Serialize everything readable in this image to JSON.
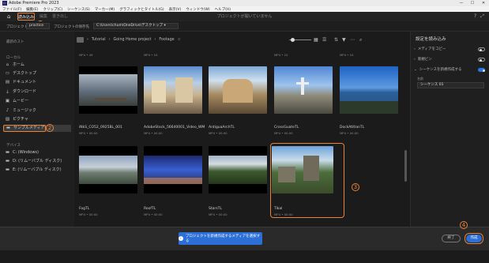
{
  "window": {
    "title": "Adobe Premiere Pro 2023",
    "controls": [
      "—",
      "☐",
      "✕"
    ]
  },
  "menu": [
    "ファイル(F)",
    "編集(E)",
    "クリップ(C)",
    "シーケンス(S)",
    "マーカー(M)",
    "グラフィックとタイトル(G)",
    "表示(V)",
    "ウィンドウ(W)",
    "ヘルプ(H)"
  ],
  "tabs": [
    {
      "label": "読み込み",
      "active": true
    },
    {
      "label": "編集",
      "active": false
    },
    {
      "label": "書き出し",
      "active": false
    }
  ],
  "center_title": "プロジェクトが開いていません",
  "project": {
    "name_label": "プロジェクト名",
    "name_value": "practice",
    "location_label": "プロジェクトの保存先",
    "location_value": "C:\\Users\\chum\\OneDrive\\デスクトップ ▾"
  },
  "sidebar": {
    "recent_heading": "最新のスト",
    "local_heading": "ローカル",
    "local_items": [
      {
        "icon": "home-icon",
        "glyph": "⌂",
        "label": "ホーム"
      },
      {
        "icon": "desktop-icon",
        "glyph": "▭",
        "label": "デスクトップ"
      },
      {
        "icon": "document-icon",
        "glyph": "▤",
        "label": "ドキュメント"
      },
      {
        "icon": "download-icon",
        "glyph": "⤓",
        "label": "ダウンロード"
      },
      {
        "icon": "movie-icon",
        "glyph": "▣",
        "label": "ムービー"
      },
      {
        "icon": "music-icon",
        "glyph": "♪",
        "label": "ミュージック"
      },
      {
        "icon": "picture-icon",
        "glyph": "▨",
        "label": "ピクチャ"
      },
      {
        "icon": "folder-icon",
        "glyph": "▬",
        "label": "サンプルメディア"
      }
    ],
    "device_heading": "デバイス",
    "device_items": [
      {
        "icon": "drive-icon",
        "glyph": "▬",
        "label": "C: (Windows)"
      },
      {
        "icon": "drive-icon",
        "glyph": "▬",
        "label": "D: (リムーバブル ディスク)"
      },
      {
        "icon": "drive-icon",
        "glyph": "▬",
        "label": "E: (リムーバブル ディスク)"
      }
    ]
  },
  "breadcrumb": [
    "Tutorial",
    "Going Home project",
    "Footage"
  ],
  "top_row_meta": [
    "MP4 • 49",
    "MP4 • 10",
    "",
    "",
    "MP4 • 10",
    "MP4 • 10"
  ],
  "clips_row1": [
    {
      "name": "iNkS_CO52_0925BL_001",
      "meta": "MP4 • 00:00"
    },
    {
      "name": "AdobeStock_56640001_Video_WM",
      "meta": "MP4 • 00:00"
    },
    {
      "name": "AntiguaArchTL",
      "meta": "MP4 • 00:00"
    },
    {
      "name": "CrossGuateTL",
      "meta": "MP4 • 00:00"
    },
    {
      "name": "DockAtitlanTL",
      "meta": "MP4 • 00:00"
    }
  ],
  "clips_row2": [
    {
      "name": "FogTL",
      "meta": "MP4 • 00:00"
    },
    {
      "name": "RoofTL",
      "meta": "MP4 • 00:00"
    },
    {
      "name": "StarsTL",
      "meta": "MP4 • 00:00"
    },
    {
      "name": "Tikal",
      "meta": "MP4 • 00:00"
    }
  ],
  "settings": {
    "heading": "設定を読み込み",
    "copy_media": "メディアをコピー",
    "new_bin": "新規ビン",
    "create_sequence": "シーケンスを新規作成する",
    "name_label": "名前",
    "sequence_name": "シーケンス 01"
  },
  "bottom": {
    "note": "プロジェクトを新規作成するメディアを選択する",
    "exit": "終了",
    "create": "作成"
  },
  "callouts": [
    "1",
    "2",
    "3",
    "4"
  ],
  "colors": {
    "accent": "#2c6fd6",
    "callout": "#e8833a"
  }
}
